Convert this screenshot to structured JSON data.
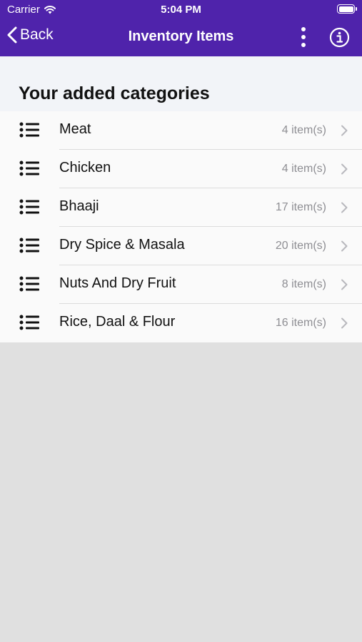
{
  "status_bar": {
    "carrier": "Carrier",
    "time": "5:04 PM",
    "battery_level": 1.0
  },
  "navbar": {
    "back_label": "Back",
    "title": "Inventory Items",
    "more_icon": "more-vertical-icon",
    "info_icon": "info-icon"
  },
  "section": {
    "title": "Your added categories"
  },
  "categories": [
    {
      "name": "Meat",
      "count": "4 item(s)"
    },
    {
      "name": "Chicken",
      "count": "4 item(s)"
    },
    {
      "name": "Bhaaji",
      "count": "17 item(s)"
    },
    {
      "name": "Dry Spice & Masala",
      "count": "20 item(s)"
    },
    {
      "name": "Nuts And Dry Fruit",
      "count": "8 item(s)"
    },
    {
      "name": "Rice, Daal & Flour",
      "count": "16 item(s)"
    }
  ],
  "colors": {
    "header": "#4f23ab",
    "content_bg": "#f2f4f8",
    "page_bg": "#e0e0e0",
    "secondary_text": "#8e8e93"
  }
}
